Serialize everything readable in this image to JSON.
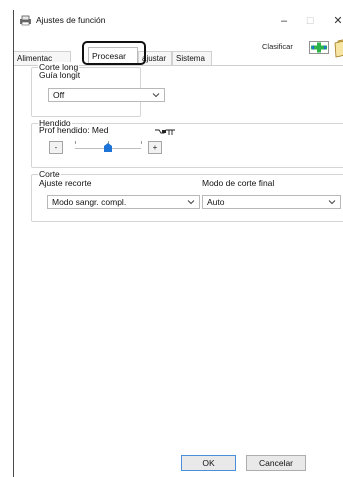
{
  "window": {
    "title": "Ajustes de función",
    "controls": {
      "minimize": "–",
      "maximize": "☐",
      "close": "✕"
    }
  },
  "tabs": [
    {
      "label": "Alimentación",
      "display": "Alimentac",
      "active": false
    },
    {
      "label": "Procesar",
      "active": true
    },
    {
      "label": "Ajustar",
      "display": "ajustar",
      "active": false
    },
    {
      "label": "Sistema",
      "active": false
    }
  ],
  "toolbar": {
    "clasificar_label": "Clasificar",
    "icon": "sort-icon"
  },
  "corte_longitudinal": {
    "group_title": "Corte long",
    "guia_label": "Guía longit",
    "guia_value": "Off"
  },
  "hendido": {
    "group_title": "Hendido",
    "prof_label": "Prof hendido: Med",
    "minus_label": "-",
    "plus_label": "+",
    "level": 0.5
  },
  "corte": {
    "group_title": "Corte",
    "ajuste_label": "Ajuste recorte",
    "ajuste_value": "Modo sangr. compl.",
    "modo_label": "Modo de corte final",
    "modo_value": "Auto"
  },
  "footer": {
    "ok_label": "OK",
    "cancel_label": "Cancelar"
  },
  "colors": {
    "accent": "#4a90d9",
    "highlight": "#111111",
    "slider_thumb": "#1e73d6"
  }
}
